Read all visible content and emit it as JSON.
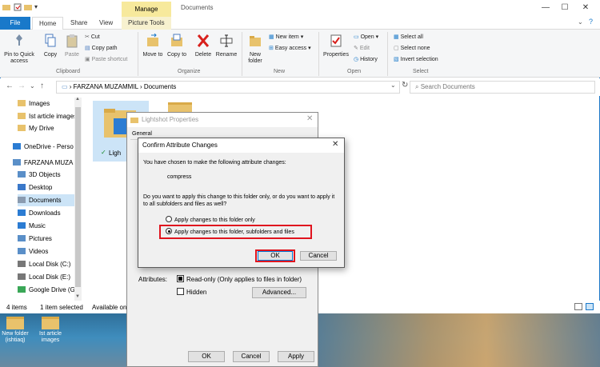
{
  "window": {
    "title": "Documents",
    "contextual_tab": "Manage",
    "controls": [
      "—",
      "☐",
      "✕"
    ]
  },
  "tabs": [
    "File",
    "Home",
    "Share",
    "View",
    "Picture Tools"
  ],
  "ribbon": {
    "clipboard": {
      "pin_label": "Pin to Quick access",
      "copy_label": "Copy",
      "paste_label": "Paste",
      "cut_label": "Cut",
      "copy_path_label": "Copy path",
      "paste_shortcut_label": "Paste shortcut",
      "group_label": "Clipboard"
    },
    "organize": {
      "move_label": "Move to",
      "copy_label": "Copy to",
      "delete_label": "Delete",
      "rename_label": "Rename",
      "group_label": "Organize"
    },
    "new": {
      "new_folder_label": "New folder",
      "new_item_label": "New item",
      "easy_access_label": "Easy access",
      "group_label": "New"
    },
    "open": {
      "properties_label": "Properties",
      "open_label": "Open",
      "edit_label": "Edit",
      "history_label": "History",
      "group_label": "Open"
    },
    "select": {
      "select_all_label": "Select all",
      "select_none_label": "Select none",
      "invert_label": "Invert selection",
      "group_label": "Select"
    }
  },
  "address": {
    "path_root": "FARZANA MUZAMMIL",
    "path_current": "Documents",
    "search_placeholder": "Search Documents"
  },
  "nav": {
    "items": [
      {
        "label": "Images",
        "color": "#e8c26c"
      },
      {
        "label": "Ist article images",
        "color": "#e8c26c"
      },
      {
        "label": "My Drive",
        "color": "#e8c26c"
      },
      {
        "label": "OneDrive - Person",
        "color": "#2b7cd3"
      },
      {
        "label": "FARZANA MUZAM",
        "color": "#5a8fc8"
      },
      {
        "label": "3D Objects",
        "color": "#5a8fc8"
      },
      {
        "label": "Desktop",
        "color": "#3a78c9"
      },
      {
        "label": "Documents",
        "color": "#8a9bb0"
      },
      {
        "label": "Downloads",
        "color": "#2b7cd3"
      },
      {
        "label": "Music",
        "color": "#2b7cd3"
      },
      {
        "label": "Pictures",
        "color": "#5a8fc8"
      },
      {
        "label": "Videos",
        "color": "#5a8fc8"
      },
      {
        "label": "Local Disk (C:)",
        "color": "#777777"
      },
      {
        "label": "Local Disk (E:)",
        "color": "#777777"
      },
      {
        "label": "Google Drive (G:",
        "color": "#3aa757"
      }
    ]
  },
  "content": {
    "folder_label": "Ligh"
  },
  "status": {
    "items_count": "4 items",
    "selected": "1 item selected",
    "available": "Available on"
  },
  "properties_dialog": {
    "title": "Lightshot Properties",
    "first_tab": "General",
    "attributes_label": "Attributes:",
    "readonly_label": "Read-only (Only applies to files in folder)",
    "hidden_label": "Hidden",
    "advanced_label": "Advanced...",
    "ok_label": "OK",
    "cancel_label": "Cancel",
    "apply_label": "Apply"
  },
  "confirm_dialog": {
    "title": "Confirm Attribute Changes",
    "intro": "You have chosen to make the following attribute changes:",
    "change": "compress",
    "question": "Do you want to apply this change to this folder only, or do you want to apply it to all subfolders and files as well?",
    "option_folder_only": "Apply changes to this folder only",
    "option_all": "Apply changes to this folder, subfolders and files",
    "ok_label": "OK",
    "cancel_label": "Cancel",
    "highlight_color": "#e0141e"
  },
  "desktop": {
    "icon1": "New folder (ishtiaq)",
    "icon2": "Ist article images"
  }
}
